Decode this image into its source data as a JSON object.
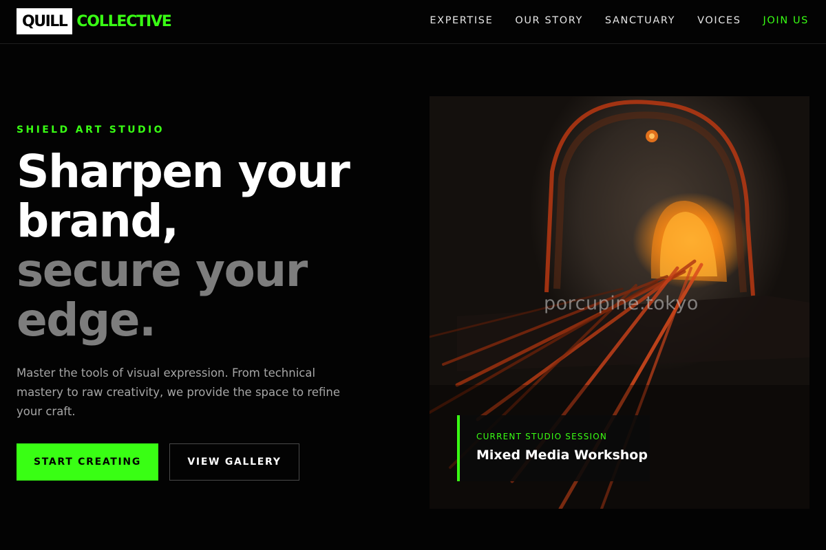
{
  "header": {
    "logo_box": "QUILL",
    "logo_word": "COLLECTIVE",
    "nav": [
      "EXPERTISE",
      "OUR STORY",
      "SANCTUARY",
      "VOICES",
      "JOIN US"
    ]
  },
  "hero": {
    "eyebrow": "SHIELD ART STUDIO",
    "headline_white": [
      "Sharpen your",
      "brand,"
    ],
    "headline_gray": [
      "secure your",
      "edge."
    ],
    "description": "Master the tools of visual expression. From technical mastery to raw creativity, we provide the space to refine your craft.",
    "primary_button": "START CREATING",
    "secondary_button": "VIEW GALLERY"
  },
  "image": {
    "watermark": "porcupine.tokyo",
    "session_label": "CURRENT STUDIO SESSION",
    "session_title": "Mixed Media Workshop"
  },
  "colors": {
    "accent": "#39ff14",
    "background": "#030303",
    "muted_headline": "#7d7d7d"
  }
}
